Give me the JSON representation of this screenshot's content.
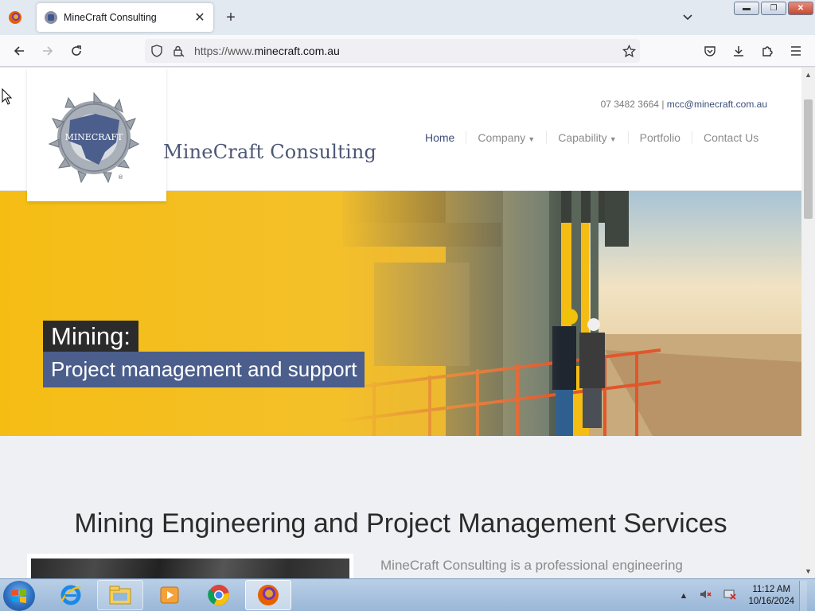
{
  "browser": {
    "tab": {
      "title": "MineCraft Consulting"
    },
    "url": {
      "prefix": "https://www.",
      "domain": "minecraft.com.au"
    }
  },
  "site": {
    "logo_text": "MINECRAFT",
    "brand_name": "MineCraft Consulting",
    "phone": "07 3482 3664",
    "separator": " | ",
    "email": "mcc@minecraft.com.au",
    "nav": [
      {
        "label": "Home",
        "dropdown": false
      },
      {
        "label": "Company",
        "dropdown": true
      },
      {
        "label": "Capability",
        "dropdown": true
      },
      {
        "label": "Portfolio",
        "dropdown": false
      },
      {
        "label": "Contact Us",
        "dropdown": false
      }
    ],
    "hero": {
      "line1": "Mining:",
      "line2": "Project management and support"
    },
    "heading": "Mining Engineering and Project Management Services",
    "intro": "MineCraft Consulting is a professional engineering"
  },
  "taskbar": {
    "time": "11:12 AM",
    "date": "10/16/2024"
  },
  "colors": {
    "brand_blue": "#4b5e8c",
    "hero_yellow": "#f5bd14",
    "nav_active": "#3d4e7a"
  }
}
